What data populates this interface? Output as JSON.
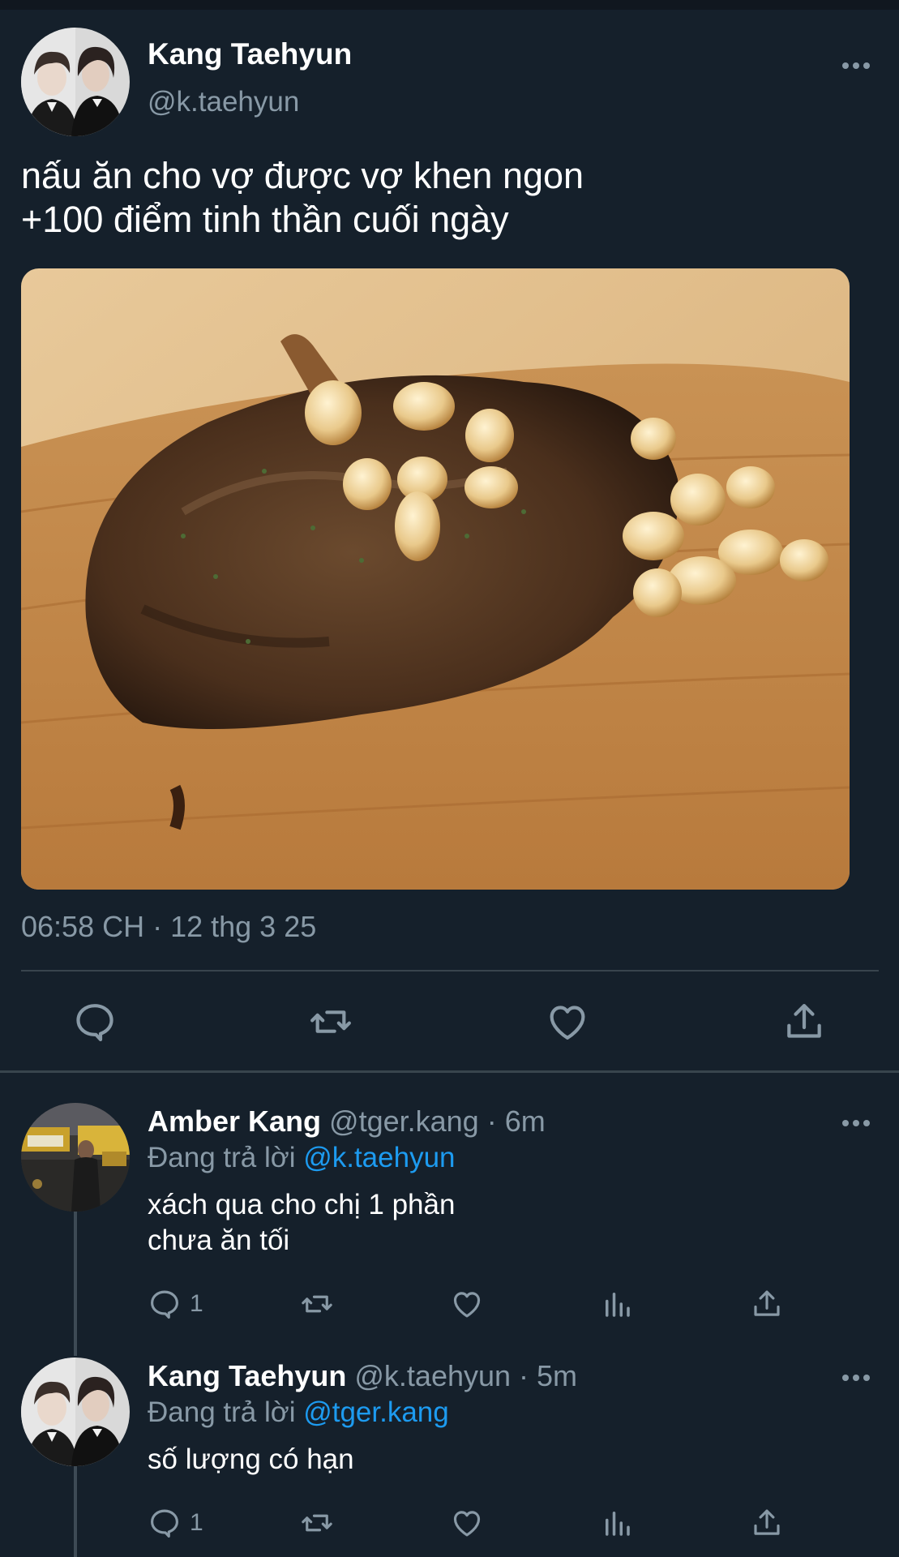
{
  "colors": {
    "background": "#15202b",
    "secondary_text": "#8899a6",
    "link": "#1d9bf0",
    "divider": "#38444d"
  },
  "main_tweet": {
    "display_name": "Kang Taehyun",
    "handle": "@k.taehyun",
    "text_lines": [
      "nấu ăn cho vợ được vợ khen ngon",
      "+100 điểm tinh thần cuối ngày"
    ],
    "timestamp": "06:58 CH · 12 thg 3 25",
    "actions": [
      "reply-icon",
      "retweet-icon",
      "like-icon",
      "share-icon"
    ]
  },
  "replies": [
    {
      "display_name": "Amber Kang",
      "meta": "@tger.kang · 6m",
      "replying_prefix": "Đang trả lời",
      "replying_to": "@k.taehyun",
      "text_lines": [
        "xách qua cho chị 1 phần",
        "chưa ăn tối"
      ],
      "reply_count": "1"
    },
    {
      "display_name": "Kang Taehyun",
      "meta": "@k.taehyun · 5m",
      "replying_prefix": "Đang trả lời",
      "replying_to": "@tger.kang",
      "text_lines": [
        "số lượng có hạn"
      ],
      "reply_count": "1"
    }
  ]
}
